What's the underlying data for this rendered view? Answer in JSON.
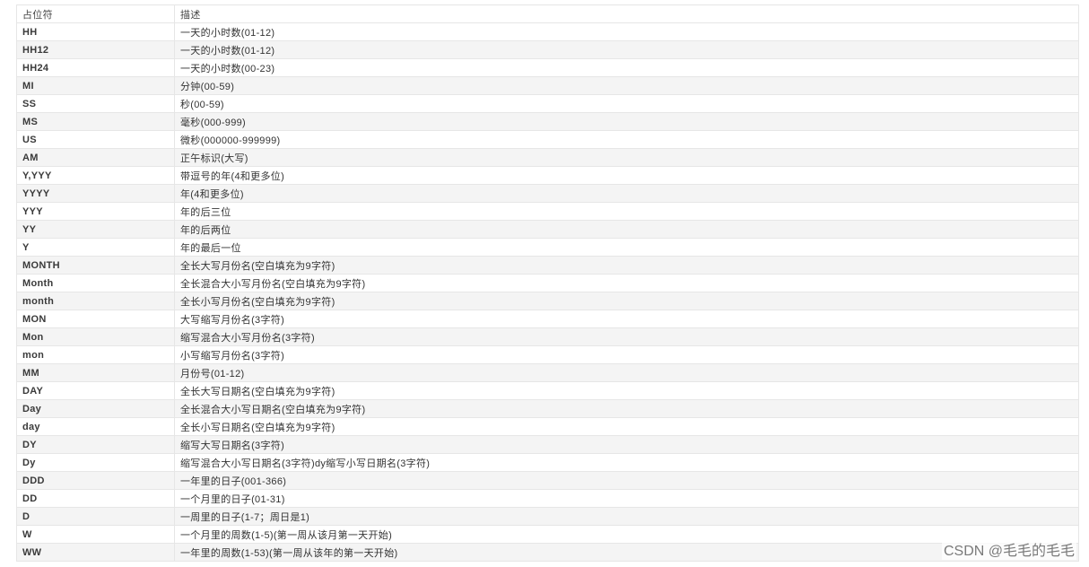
{
  "table": {
    "headers": {
      "placeholder": "占位符",
      "description": "描述"
    },
    "rows": [
      {
        "code": "HH",
        "desc": "一天的小时数(01-12)"
      },
      {
        "code": "HH12",
        "desc": "一天的小时数(01-12)"
      },
      {
        "code": "HH24",
        "desc": "一天的小时数(00-23)"
      },
      {
        "code": "MI",
        "desc": "分钟(00-59)"
      },
      {
        "code": "SS",
        "desc": "秒(00-59)"
      },
      {
        "code": "MS",
        "desc": "毫秒(000-999)"
      },
      {
        "code": "US",
        "desc": "微秒(000000-999999)"
      },
      {
        "code": "AM",
        "desc": "正午标识(大写)"
      },
      {
        "code": "Y,YYY",
        "desc": "带逗号的年(4和更多位)"
      },
      {
        "code": "YYYY",
        "desc": "年(4和更多位)"
      },
      {
        "code": "YYY",
        "desc": "年的后三位"
      },
      {
        "code": "YY",
        "desc": "年的后两位"
      },
      {
        "code": "Y",
        "desc": "年的最后一位"
      },
      {
        "code": "MONTH",
        "desc": "全长大写月份名(空白填充为9字符)"
      },
      {
        "code": "Month",
        "desc": "全长混合大小写月份名(空白填充为9字符)"
      },
      {
        "code": "month",
        "desc": "全长小写月份名(空白填充为9字符)"
      },
      {
        "code": "MON",
        "desc": "大写缩写月份名(3字符)"
      },
      {
        "code": "Mon",
        "desc": "缩写混合大小写月份名(3字符)"
      },
      {
        "code": "mon",
        "desc": "小写缩写月份名(3字符)"
      },
      {
        "code": "MM",
        "desc": "月份号(01-12)"
      },
      {
        "code": "DAY",
        "desc": "全长大写日期名(空白填充为9字符)"
      },
      {
        "code": "Day",
        "desc": "全长混合大小写日期名(空白填充为9字符)"
      },
      {
        "code": "day",
        "desc": "全长小写日期名(空白填充为9字符)"
      },
      {
        "code": "DY",
        "desc": "缩写大写日期名(3字符)"
      },
      {
        "code": "Dy",
        "desc": "缩写混合大小写日期名(3字符)dy缩写小写日期名(3字符)"
      },
      {
        "code": "DDD",
        "desc": "一年里的日子(001-366)"
      },
      {
        "code": "DD",
        "desc": "一个月里的日子(01-31)"
      },
      {
        "code": "D",
        "desc": "一周里的日子(1-7；周日是1)"
      },
      {
        "code": "W",
        "desc": "一个月里的周数(1-5)(第一周从该月第一天开始)"
      },
      {
        "code": "WW",
        "desc": "一年里的周数(1-53)(第一周从该年的第一天开始)"
      }
    ]
  },
  "watermark": "CSDN @毛毛的毛毛"
}
